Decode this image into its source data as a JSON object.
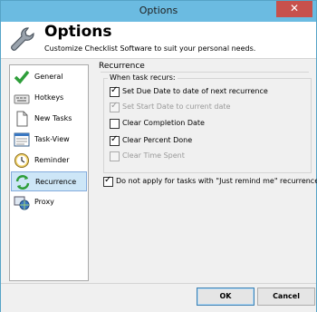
{
  "window": {
    "title": "Options",
    "close_glyph": "✕"
  },
  "header": {
    "title": "Options",
    "subtitle": "Customize Checklist Software to suit your personal needs.",
    "icon": "wrench-icon"
  },
  "sidebar": {
    "items": [
      {
        "label": "General",
        "icon": "green-check-icon",
        "selected": false
      },
      {
        "label": "Hotkeys",
        "icon": "keyboard-icon",
        "selected": false
      },
      {
        "label": "New Tasks",
        "icon": "new-document-icon",
        "selected": false
      },
      {
        "label": "Task-View",
        "icon": "task-view-icon",
        "selected": false
      },
      {
        "label": "Reminder",
        "icon": "clock-icon",
        "selected": false
      },
      {
        "label": "Recurrence",
        "icon": "recurrence-arrows-icon",
        "selected": true
      },
      {
        "label": "Proxy",
        "icon": "globe-icon",
        "selected": false
      }
    ]
  },
  "recurrence": {
    "section_title": "Recurrence",
    "group_label": "When task recurs:",
    "options": [
      {
        "label": "Set Due Date to date of next recurrence",
        "checked": true,
        "enabled": true
      },
      {
        "label": "Set Start Date to current date",
        "checked": true,
        "enabled": false
      },
      {
        "label": "Clear Completion Date",
        "checked": false,
        "enabled": true
      },
      {
        "label": "Clear Percent Done",
        "checked": true,
        "enabled": true
      },
      {
        "label": "Clear Time Spent",
        "checked": false,
        "enabled": false
      }
    ],
    "extra_option": {
      "label": "Do not apply for tasks with \"Just remind me\" recurrence",
      "checked": true,
      "enabled": true
    }
  },
  "buttons": {
    "ok": "OK",
    "cancel": "Cancel"
  },
  "colors": {
    "titlebar": "#6bbbe1",
    "close": "#c7514c",
    "selection": "#cde6f7"
  }
}
